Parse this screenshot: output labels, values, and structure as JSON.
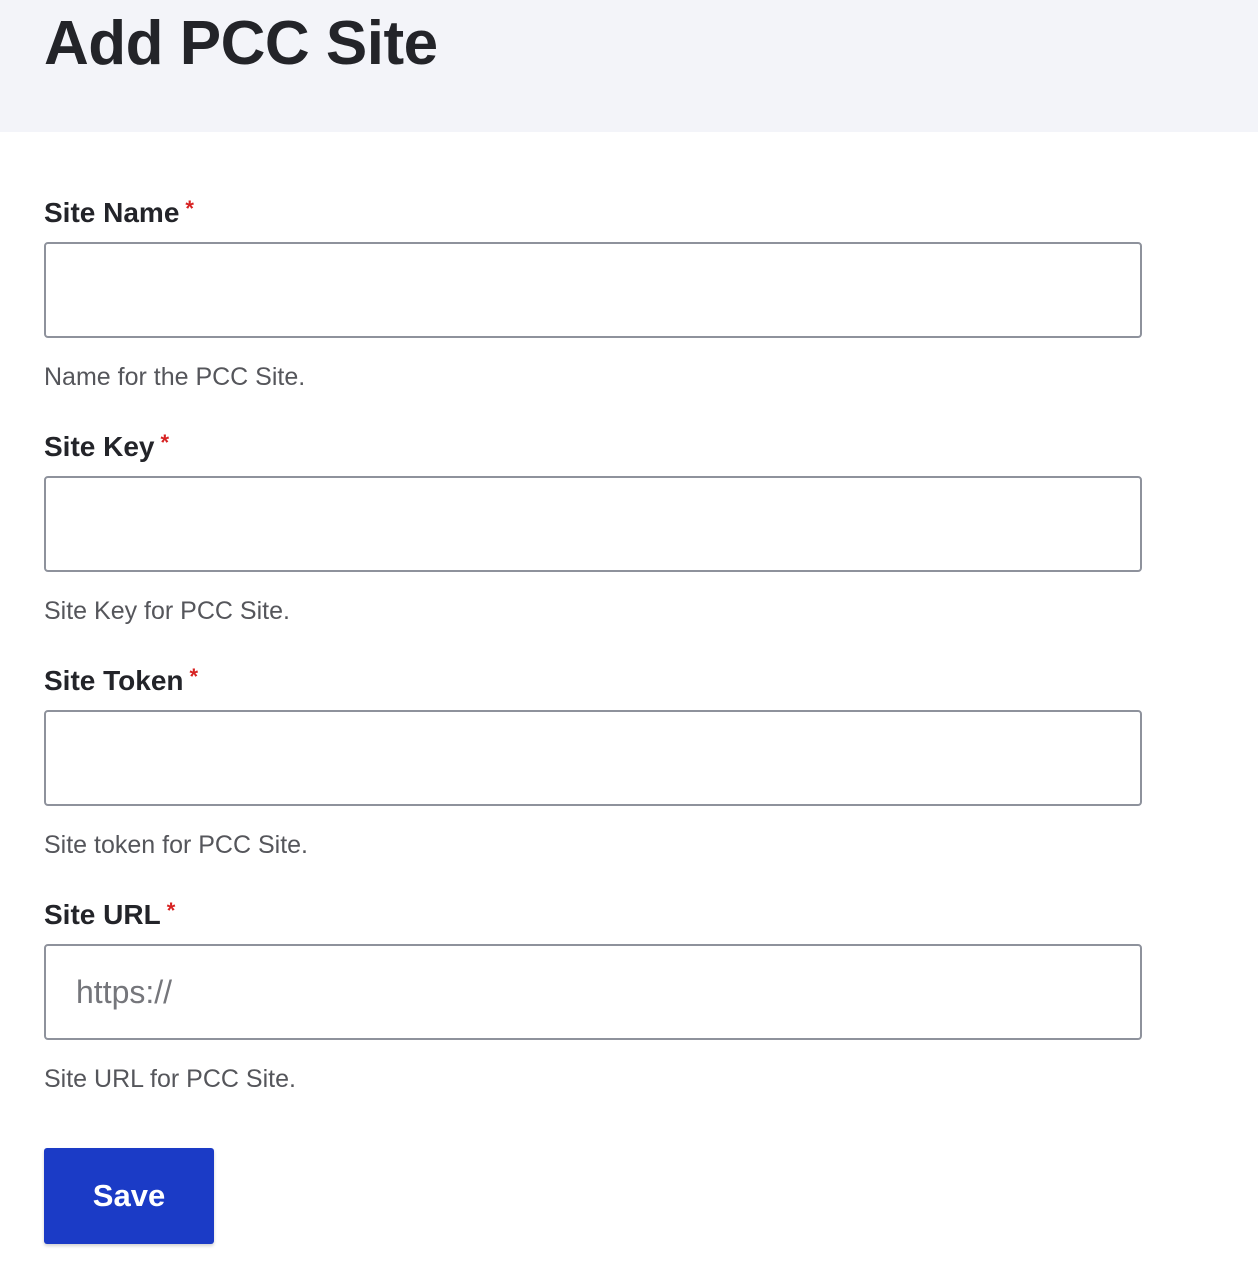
{
  "header": {
    "title": "Add PCC Site"
  },
  "form": {
    "required_mark": "*",
    "fields": [
      {
        "label": "Site Name",
        "value": "",
        "placeholder": "",
        "description": "Name for the PCC Site."
      },
      {
        "label": "Site Key",
        "value": "",
        "placeholder": "",
        "description": "Site Key for PCC Site."
      },
      {
        "label": "Site Token",
        "value": "",
        "placeholder": "",
        "description": "Site token for PCC Site."
      },
      {
        "label": "Site URL",
        "value": "",
        "placeholder": "https://",
        "description": "Site URL for PCC Site."
      }
    ],
    "save_label": "Save"
  },
  "colors": {
    "header_background": "#f3f4f9",
    "required": "#d72222",
    "primary_button": "#1b3bc6",
    "input_border": "#8e929c"
  }
}
